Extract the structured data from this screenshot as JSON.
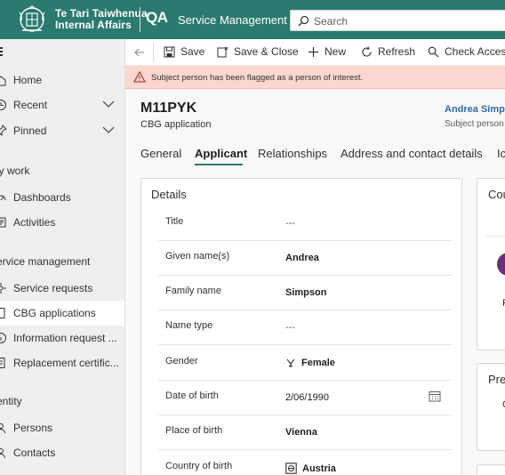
{
  "topbar": {
    "org_line1": "Te Tari Taiwhenua",
    "org_line2": "Internal Affairs",
    "env_badge": "QA",
    "app_name": "Service Management",
    "search_placeholder": "Search"
  },
  "sidebar": {
    "items_top": [
      {
        "label": "Home",
        "icon": "home-icon"
      },
      {
        "label": "Recent",
        "icon": "clock-icon",
        "expandable": true
      },
      {
        "label": "Pinned",
        "icon": "pin-icon",
        "expandable": true
      }
    ],
    "section_my_work": "ly work",
    "my_work_items": [
      {
        "label": "Dashboards",
        "icon": "dashboard-icon"
      },
      {
        "label": "Activities",
        "icon": "activities-icon"
      }
    ],
    "section_service": "ervice management",
    "service_items": [
      {
        "label": "Service requests",
        "icon": "service-request-icon"
      },
      {
        "label": "CBG applications",
        "icon": "document-icon",
        "active": true
      },
      {
        "label": "Information request ...",
        "icon": "info-icon"
      },
      {
        "label": "Replacement certific...",
        "icon": "certificate-icon"
      }
    ],
    "section_identity": "entity",
    "identity_items": [
      {
        "label": "Persons",
        "icon": "person-icon"
      },
      {
        "label": "Contacts",
        "icon": "contact-icon"
      }
    ]
  },
  "commandbar": {
    "save": "Save",
    "save_close": "Save & Close",
    "new": "New",
    "refresh": "Refresh",
    "check_access": "Check Access"
  },
  "warning": {
    "message": "Subject person has been flagged as a person of interest."
  },
  "record": {
    "title": "M11PYK",
    "subtitle": "CBG application",
    "owner_name": "Andrea Simps",
    "owner_label": "Subject person"
  },
  "tabs": [
    "General",
    "Applicant",
    "Relationships",
    "Address and contact details",
    "Ic"
  ],
  "details": {
    "title": "Details",
    "fields": [
      {
        "label": "Title",
        "value": "---"
      },
      {
        "label": "Given name(s)",
        "value": "Andrea"
      },
      {
        "label": "Family name",
        "value": "Simpson"
      },
      {
        "label": "Name type",
        "value": "---"
      },
      {
        "label": "Gender",
        "value": "Female"
      },
      {
        "label": "Date of birth",
        "value": "2/06/1990"
      },
      {
        "label": "Place of birth",
        "value": "Vienna"
      },
      {
        "label": "Country of birth",
        "value": "Austria"
      }
    ]
  },
  "right_cards": {
    "card1_title": "Cou",
    "card1_letter": "F",
    "card2_title": "Pre",
    "card2_letter": "C"
  },
  "colors": {
    "topbar": "#2a7a6f",
    "warning_bg": "#fcd7cf",
    "link": "#2b6cb0",
    "avatar": "#6b2e7a"
  }
}
